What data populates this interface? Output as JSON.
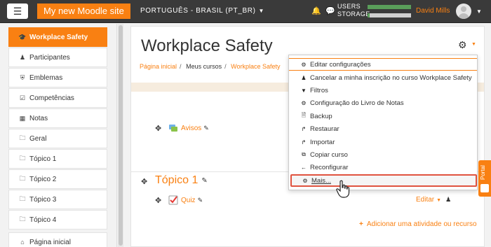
{
  "navbar": {
    "menu_icon": "hamburger-icon",
    "site_name": "My new Moodle site",
    "language": "PORTUGUÊS - BRASIL (PT_BR)",
    "storage_label_users": "USERS",
    "storage_label_storage": "STORAGE",
    "users_bar_fill": 1.0,
    "storage_bar_fill": 0.05,
    "user_name": "David Mills",
    "brand_color": "#f98012"
  },
  "sidebar": {
    "items": [
      {
        "label": "Workplace Safety",
        "icon": "graduation-cap-icon",
        "active": true
      },
      {
        "label": "Participantes",
        "icon": "users-icon"
      },
      {
        "label": "Emblemas",
        "icon": "shield-icon"
      },
      {
        "label": "Competências",
        "icon": "checkbox-icon"
      },
      {
        "label": "Notas",
        "icon": "table-icon"
      },
      {
        "label": "Geral",
        "icon": "folder-icon"
      },
      {
        "label": "Tópico 1",
        "icon": "folder-icon"
      },
      {
        "label": "Tópico 2",
        "icon": "folder-icon"
      },
      {
        "label": "Tópico 3",
        "icon": "folder-icon"
      },
      {
        "label": "Tópico 4",
        "icon": "folder-icon"
      },
      {
        "label": "Página inicial",
        "icon": "home-icon"
      }
    ]
  },
  "main": {
    "title": "Workplace Safety",
    "breadcrumb": [
      "Página inicial",
      "Meus cursos",
      "Workplace Safety"
    ],
    "activities": {
      "forum": "Avisos",
      "quiz": "Quiz"
    },
    "section_title": "Tópico 1",
    "edit_label": "Editar",
    "add_activity": "Adicionar uma atividade ou recurso"
  },
  "dropdown": {
    "items": [
      {
        "label": "Editar configurações",
        "icon": "gear-icon"
      },
      {
        "label": "Cancelar a minha inscrição no curso Workplace Safety",
        "icon": "user-icon"
      },
      {
        "label": "Filtros",
        "icon": "filter-icon"
      },
      {
        "label": "Configuração do Livro de Notas",
        "icon": "gear-icon"
      },
      {
        "label": "Backup",
        "icon": "file-icon"
      },
      {
        "label": "Restaurar",
        "icon": "level-up-icon"
      },
      {
        "label": "Importar",
        "icon": "level-up-icon"
      },
      {
        "label": "Copiar curso",
        "icon": "copy-icon"
      },
      {
        "label": "Reconfigurar",
        "icon": "arrow-left-icon"
      },
      {
        "label": "Mais...",
        "icon": "gear-icon"
      }
    ]
  },
  "portal_tab": "Portal"
}
